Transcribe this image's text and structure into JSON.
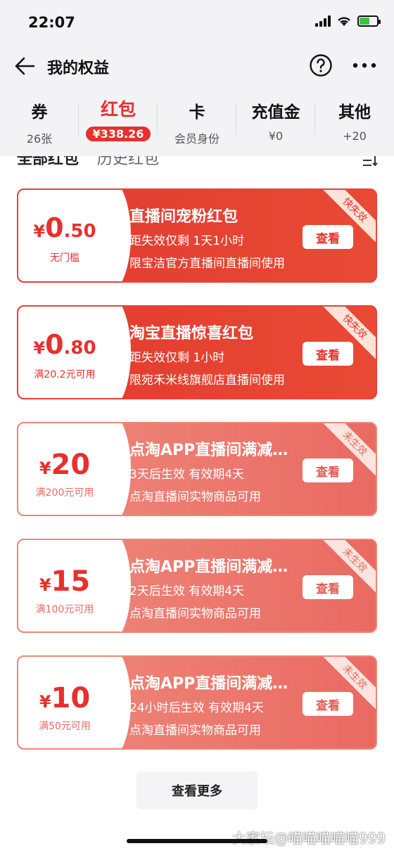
{
  "status_bar": {
    "time": "22:07"
  },
  "nav": {
    "title": "我的权益"
  },
  "tabs": [
    {
      "label": "券",
      "sub": "26张",
      "active": false
    },
    {
      "label": "红包",
      "sub": "¥338.26",
      "active": true
    },
    {
      "label": "卡",
      "sub": "会员身份",
      "active": false
    },
    {
      "label": "充值金",
      "sub": "¥0",
      "active": false
    },
    {
      "label": "其他",
      "sub": "+20",
      "active": false
    }
  ],
  "filters": {
    "all": "全部红包",
    "history": "历史红包"
  },
  "cards": [
    {
      "currency": "¥",
      "amount_int": "0",
      "amount_dec": ".50",
      "condition": "无门槛",
      "title": "直播间宠粉红包",
      "line1": "距失效仅剩 1天1小时",
      "line2": "限宝洁官方直播间直播间使用",
      "button": "查看",
      "ribbon": "快失效",
      "state": "urgent"
    },
    {
      "currency": "¥",
      "amount_int": "0",
      "amount_dec": ".80",
      "condition": "满20.2元可用",
      "title": "淘宝直播惊喜红包",
      "line1": "距失效仅剩 1小时",
      "line2": "限宛禾米线旗舰店直播间使用",
      "button": "查看",
      "ribbon": "快失效",
      "state": "urgent"
    },
    {
      "currency": "¥",
      "amount_int": "20",
      "amount_dec": "",
      "condition": "满200元可用",
      "title": "点淘APP直播间满减…",
      "line1": "3天后生效 有效期4天",
      "line2": "点淘直播间实物商品可用",
      "button": "查看",
      "ribbon": "未生效",
      "state": "pending"
    },
    {
      "currency": "¥",
      "amount_int": "15",
      "amount_dec": "",
      "condition": "满100元可用",
      "title": "点淘APP直播间满减…",
      "line1": "2天后生效 有效期4天",
      "line2": "点淘直播间实物商品可用",
      "button": "查看",
      "ribbon": "未生效",
      "state": "pending"
    },
    {
      "currency": "¥",
      "amount_int": "10",
      "amount_dec": "",
      "condition": "满50元可用",
      "title": "点淘APP直播间满减…",
      "line1": "24小时后生效 有效期4天",
      "line2": "点淘直播间实物商品可用",
      "button": "查看",
      "ribbon": "未生效",
      "state": "pending"
    }
  ],
  "more_button": "查看更多",
  "watermark": "大家坛@喵喵喵喵喵999",
  "colors": {
    "accent": "#e8302c",
    "urgent": "#e23a2f",
    "pending": "#ee8a7c"
  },
  "icons": {
    "back": "arrow-left-icon",
    "help": "question-circle-icon",
    "more": "more-dots-icon",
    "filter": "list-filter-icon"
  }
}
